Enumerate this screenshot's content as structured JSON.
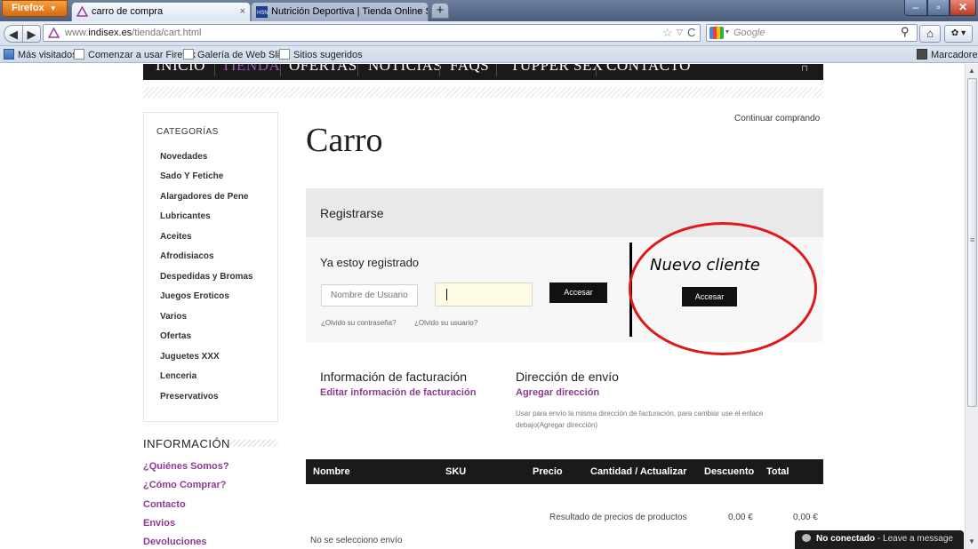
{
  "browser": {
    "app_button": "Firefox",
    "tabs": [
      {
        "label": "carro de compra",
        "active": true
      },
      {
        "label": "Nutrición Deportiva | Tienda Online S...",
        "active": false
      }
    ],
    "url_prefix": "www.",
    "url_domain": "indisex.es",
    "url_path": "/tienda/cart.html",
    "search_placeholder": "Google",
    "bookmarks": [
      "Más visitados",
      "Comenzar a usar Firefox",
      "Galería de Web Slice",
      "Sitios sugeridos"
    ],
    "bookmarks_right": "Marcadores"
  },
  "site_menu": [
    "INICIO",
    "TIENDA",
    "OFERTAS",
    "NOTICIAS",
    "FAQS",
    "TUPPER SEX",
    "CONTACTO"
  ],
  "sidebar": {
    "categories_title": "CATEGORÍAS",
    "categories": [
      "Novedades",
      "Sado Y Fetiche",
      "Alargadores de Pene",
      "Lubricantes",
      "Aceites",
      "Afrodisiacos",
      "Despedidas y Bromas",
      "Juegos Eroticos",
      "Varios",
      "Ofertas",
      "Juguetes XXX",
      "Lenceria",
      "Preservativos"
    ],
    "info_title": "INFORMACIÓN",
    "info_links": [
      "¿Quiénes Somos?",
      "¿Cómo Comprar?",
      "Contacto",
      "Envios",
      "Devoluciones"
    ]
  },
  "main": {
    "continue_link": "Continuar comprando",
    "title": "Carro",
    "register_title": "Registrarse",
    "registered_title": "Ya estoy registrado",
    "username_placeholder": "Nombre de Usuario",
    "password_value": "",
    "login_button": "Accesar",
    "forgot_password": "¿Olvido su contraseña?",
    "forgot_user": "¿Olvido su usuario?",
    "new_client_title": "Nuevo cliente",
    "new_client_button": "Accesar",
    "billing_title": "Información de facturación",
    "billing_link": "Editar información de facturación",
    "shipping_title": "Dirección de envío",
    "shipping_link": "Agregar dirección",
    "shipping_note": "Usar para envío la misma dirección de facturación, para cambiar use el enlace debajo(Agregar dirección)",
    "table_headers": [
      "Nombre",
      "SKU",
      "Precio",
      "Cantidad / Actualizar",
      "Descuento",
      "Total"
    ],
    "summary_label": "Resultado de precios de productos",
    "summary_discount": "0,00 €",
    "summary_total": "0,00 €",
    "no_shipping": "No se selecciono envío"
  },
  "chat": {
    "status": "No conectado",
    "message": " - Leave a message"
  },
  "colors": {
    "accent": "#8b3a93",
    "menu_active": "#9b59b6",
    "annotation": "#e01818"
  }
}
